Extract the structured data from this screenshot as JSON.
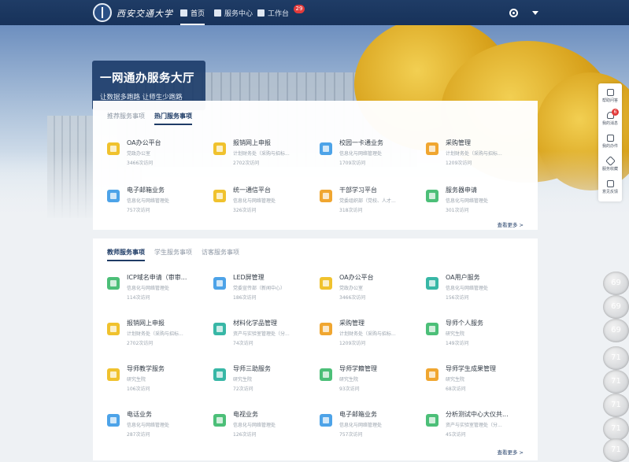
{
  "header": {
    "logo_text": "西安交通大学",
    "nav": [
      {
        "label": "首页",
        "icon": "home-icon",
        "active": true
      },
      {
        "label": "服务中心",
        "icon": "service-center-icon",
        "active": false
      },
      {
        "label": "工作台",
        "icon": "workbench-icon",
        "active": false,
        "badge": "29"
      }
    ],
    "icons": [
      "settings-icon",
      "chevron-down-icon"
    ]
  },
  "hero": {
    "title": "一网通办服务大厅",
    "subtitle": "让数据多跑路 让师生少跑路"
  },
  "section1": {
    "tabs": [
      {
        "label": "推荐服务事项",
        "active": false
      },
      {
        "label": "热门服务事项",
        "active": true
      }
    ],
    "items": [
      {
        "name": "OA办公平台",
        "desc": "党政办公室",
        "visits": "3466次访问",
        "color": "#f0c22e"
      },
      {
        "name": "报销网上申报",
        "desc": "计划财务处（采购与招标...",
        "visits": "2702次访问",
        "color": "#f0c22e"
      },
      {
        "name": "校园一卡通业务",
        "desc": "信息化与网络管理处",
        "visits": "1709次访问",
        "color": "#4da3e8"
      },
      {
        "name": "采购管理",
        "desc": "计划财务处（采购与招标...",
        "visits": "1209次访问",
        "color": "#f0a630"
      },
      {
        "name": "电子邮箱业务",
        "desc": "信息化与网络管理处",
        "visits": "757次访问",
        "color": "#4da3e8"
      },
      {
        "name": "统一通信平台",
        "desc": "信息化与网络管理处",
        "visits": "326次访问",
        "color": "#f0c22e"
      },
      {
        "name": "干部学习平台",
        "desc": "党委组织部（党校、人才...",
        "visits": "318次访问",
        "color": "#f0a630"
      },
      {
        "name": "服务器申请",
        "desc": "信息化与网络管理处",
        "visits": "301次访问",
        "color": "#4cbf78"
      }
    ],
    "more": "查看更多 >"
  },
  "section2": {
    "tabs": [
      {
        "label": "教师服务事项",
        "active": true
      },
      {
        "label": "学生服务事项",
        "active": false
      },
      {
        "label": "访客服务事项",
        "active": false
      }
    ],
    "items": [
      {
        "name": "ICP域名申请（审审...",
        "desc": "信息化与网络管理处",
        "visits": "114次访问",
        "color": "#4cbf78"
      },
      {
        "name": "LED屏管理",
        "desc": "党委宣传部（新闻中心）",
        "visits": "186次访问",
        "color": "#4da3e8"
      },
      {
        "name": "OA办公平台",
        "desc": "党政办公室",
        "visits": "3466次访问",
        "color": "#f0c22e"
      },
      {
        "name": "OA用户服务",
        "desc": "信息化与网络管理处",
        "visits": "156次访问",
        "color": "#38b7a6"
      },
      {
        "name": "报销网上申报",
        "desc": "计划财务处（采购与招标...",
        "visits": "2702次访问",
        "color": "#f0c22e"
      },
      {
        "name": "材料化学品管理",
        "desc": "资产与实验室管理处（分...",
        "visits": "74次访问",
        "color": "#38b7a6"
      },
      {
        "name": "采购管理",
        "desc": "计划财务处（采购与招标...",
        "visits": "1209次访问",
        "color": "#f0a630"
      },
      {
        "name": "导师个人服务",
        "desc": "研究生院",
        "visits": "149次访问",
        "color": "#4cbf78"
      },
      {
        "name": "导师教学服务",
        "desc": "研究生院",
        "visits": "106次访问",
        "color": "#f0c22e"
      },
      {
        "name": "导师三助服务",
        "desc": "研究生院",
        "visits": "72次访问",
        "color": "#38b7a6"
      },
      {
        "name": "导师学籍管理",
        "desc": "研究生院",
        "visits": "93次访问",
        "color": "#4cbf78"
      },
      {
        "name": "导师学生成果管理",
        "desc": "研究生院",
        "visits": "68次访问",
        "color": "#f0a630"
      },
      {
        "name": "电话业务",
        "desc": "信息化与网络管理处",
        "visits": "287次访问",
        "color": "#4da3e8"
      },
      {
        "name": "电视业务",
        "desc": "信息化与网络管理处",
        "visits": "126次访问",
        "color": "#4cbf78"
      },
      {
        "name": "电子邮箱业务",
        "desc": "信息化与网络管理处",
        "visits": "757次访问",
        "color": "#4da3e8"
      },
      {
        "name": "分析测试中心大仪共...",
        "desc": "资产与实验室管理处（分...",
        "visits": "45次访问",
        "color": "#4cbf78"
      }
    ],
    "more": "查看更多 >"
  },
  "float_panel": [
    {
      "label": "帮助问答",
      "icon": "help-icon"
    },
    {
      "label": "我的消息",
      "icon": "bell-icon",
      "badge": "6"
    },
    {
      "label": "我的办件",
      "icon": "document-icon"
    },
    {
      "label": "服务收藏",
      "icon": "star-icon"
    },
    {
      "label": "意见反馈",
      "icon": "feedback-icon"
    }
  ],
  "side_counters": [
    "69",
    "69",
    "69",
    "71",
    "71",
    "71",
    "71",
    "71"
  ]
}
